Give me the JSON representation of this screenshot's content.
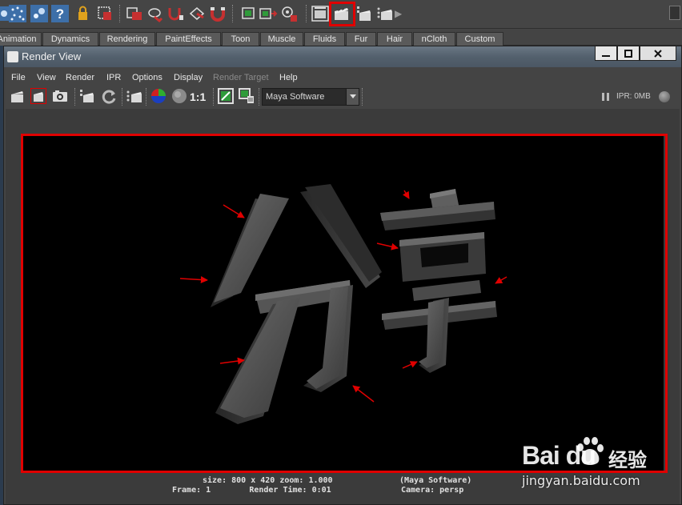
{
  "shelf": {
    "tabs": [
      "Animation",
      "Dynamics",
      "Rendering",
      "PaintEffects",
      "Toon",
      "Muscle",
      "Fluids",
      "Fur",
      "Hair",
      "nCloth",
      "Custom"
    ],
    "icons": [
      "select-icon",
      "particles-icon",
      "fluid-icon",
      "help-icon",
      "lock-icon",
      "hypershade-icon",
      "render-layer-icon",
      "visor-icon",
      "uv-icon",
      "magnet-icon",
      "snap-icon",
      "batch-icon",
      "render-sequence-icon",
      "render-settings-icon",
      "render-view-icon",
      "render-current-icon",
      "ipr-render-icon",
      "batch-render-icon"
    ]
  },
  "window": {
    "title": "Render View"
  },
  "menu": {
    "items": [
      "File",
      "View",
      "Render",
      "IPR",
      "Options",
      "Display",
      "Render Target",
      "Help"
    ],
    "disabled": [
      "Render Target"
    ]
  },
  "toolbar": {
    "ratio_label": "1:1",
    "renderer": "Maya Software",
    "ipr_label": "IPR: 0MB"
  },
  "render_info": {
    "line1_left": "size: 800 x 420 zoom: 1.000",
    "line1_right": "(Maya Software)",
    "line2_left": "Frame: 1        Render Time: 0:01",
    "line2_right": "Camera: persp"
  },
  "render_scene": {
    "characters": [
      "分",
      "享"
    ]
  },
  "watermark": {
    "logo": "Bai du",
    "cn": "经验",
    "url": "jingyan.baidu.com"
  },
  "colors": {
    "highlight": "#e00000",
    "viewport_bg": "#000000",
    "ui_bg": "#444444"
  }
}
